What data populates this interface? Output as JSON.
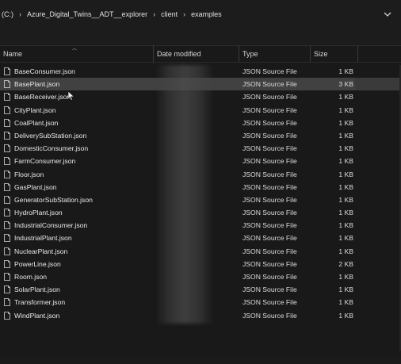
{
  "breadcrumb": {
    "items": [
      "(C:)",
      "Azure_Digital_Twins__ADT__explorer",
      "client",
      "examples"
    ],
    "separator": "›"
  },
  "columns": {
    "name": "Name",
    "date_modified": "Date modified",
    "type": "Type",
    "size": "Size"
  },
  "files": [
    {
      "name": "BaseConsumer.json",
      "type": "JSON Source File",
      "size": "1 KB"
    },
    {
      "name": "BasePlant.json",
      "type": "JSON Source File",
      "size": "3 KB",
      "selected": true
    },
    {
      "name": "BaseReceiver.json",
      "type": "JSON Source File",
      "size": "1 KB"
    },
    {
      "name": "CityPlant.json",
      "type": "JSON Source File",
      "size": "1 KB"
    },
    {
      "name": "CoalPlant.json",
      "type": "JSON Source File",
      "size": "1 KB"
    },
    {
      "name": "DeliverySubStation.json",
      "type": "JSON Source File",
      "size": "1 KB"
    },
    {
      "name": "DomesticConsumer.json",
      "type": "JSON Source File",
      "size": "1 KB"
    },
    {
      "name": "FarmConsumer.json",
      "type": "JSON Source File",
      "size": "1 KB"
    },
    {
      "name": "Floor.json",
      "type": "JSON Source File",
      "size": "1 KB"
    },
    {
      "name": "GasPlant.json",
      "type": "JSON Source File",
      "size": "1 KB"
    },
    {
      "name": "GeneratorSubStation.json",
      "type": "JSON Source File",
      "size": "1 KB"
    },
    {
      "name": "HydroPlant.json",
      "type": "JSON Source File",
      "size": "1 KB"
    },
    {
      "name": "IndustrialConsumer.json",
      "type": "JSON Source File",
      "size": "1 KB"
    },
    {
      "name": "IndustrialPlant.json",
      "type": "JSON Source File",
      "size": "1 KB"
    },
    {
      "name": "NuclearPlant.json",
      "type": "JSON Source File",
      "size": "1 KB"
    },
    {
      "name": "PowerLine.json",
      "type": "JSON Source File",
      "size": "2 KB"
    },
    {
      "name": "Room.json",
      "type": "JSON Source File",
      "size": "1 KB"
    },
    {
      "name": "SolarPlant.json",
      "type": "JSON Source File",
      "size": "1 KB"
    },
    {
      "name": "Transformer.json",
      "type": "JSON Source File",
      "size": "1 KB"
    },
    {
      "name": "WindPlant.json",
      "type": "JSON Source File",
      "size": "1 KB"
    }
  ],
  "icons": {
    "file": "json-file-icon",
    "dropdown": "chevron-down-icon",
    "cursor": "mouse-pointer-icon"
  },
  "colors": {
    "background": "#191919",
    "selected_row": "#414141",
    "text": "#e6e6e6"
  }
}
